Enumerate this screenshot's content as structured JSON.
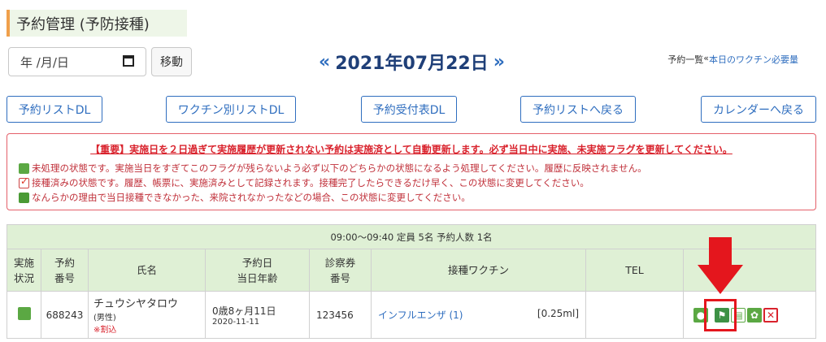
{
  "title": "予約管理 (予防接種)",
  "date_input": {
    "placeholder": "年 /月/日"
  },
  "move_button": "移動",
  "date_nav": {
    "prev": "«",
    "current": "2021年07月22日",
    "next": "»"
  },
  "toplinks": {
    "list": "予約一覧",
    "sep": " « ",
    "vaccine_need": "本日のワクチン必要量"
  },
  "buttons": [
    "予約リストDL",
    "ワクチン別リストDL",
    "予約受付表DL",
    "予約リストへ戻る",
    "カレンダーへ戻る"
  ],
  "alert": {
    "heading": "【重要】実施日を２日過ぎて実施履歴が更新されない予約は実施済として自動更新します。必ず当日中に実施、未実施フラグを更新してください。",
    "lines": [
      "未処理の状態です。実施当日をすぎてこのフラグが残らないよう必ず以下のどちらかの状態になるよう処理してください。履歴に反映されません。",
      "接種済みの状態です。履歴、帳票に、実施済みとして記録されます。接種完了したらできるだけ早く、この状態に変更してください。",
      "なんらかの理由で当日接種できなかった、来院されなかったなどの場合、この状態に変更してください。"
    ]
  },
  "table": {
    "group_title": "09:00～09:40 定員 5名 予約人数 1名",
    "headers": {
      "status": [
        "実施",
        "状況"
      ],
      "number": [
        "予約",
        "番号"
      ],
      "name": "氏名",
      "date": [
        "予約日",
        "当日年齢"
      ],
      "card": [
        "診察券",
        "番号"
      ],
      "vaccine": "接種ワクチン",
      "tel": "TEL"
    },
    "row": {
      "status_icon": "new-status-icon",
      "number": "688243",
      "name": "チュウシヤタロウ",
      "gender": "(男性)",
      "note": "※割込",
      "age": "0歳8ヶ月11日",
      "birth": "2020-11-11",
      "card": "123456",
      "vaccine": "インフルエンザ (1)",
      "dose": "[0.25ml]",
      "tel": ""
    }
  },
  "colors": {
    "accent": "#2f6ebf",
    "alert": "#d9232d",
    "header_bg": "#dff0d5",
    "highlight": "#e4161d"
  }
}
